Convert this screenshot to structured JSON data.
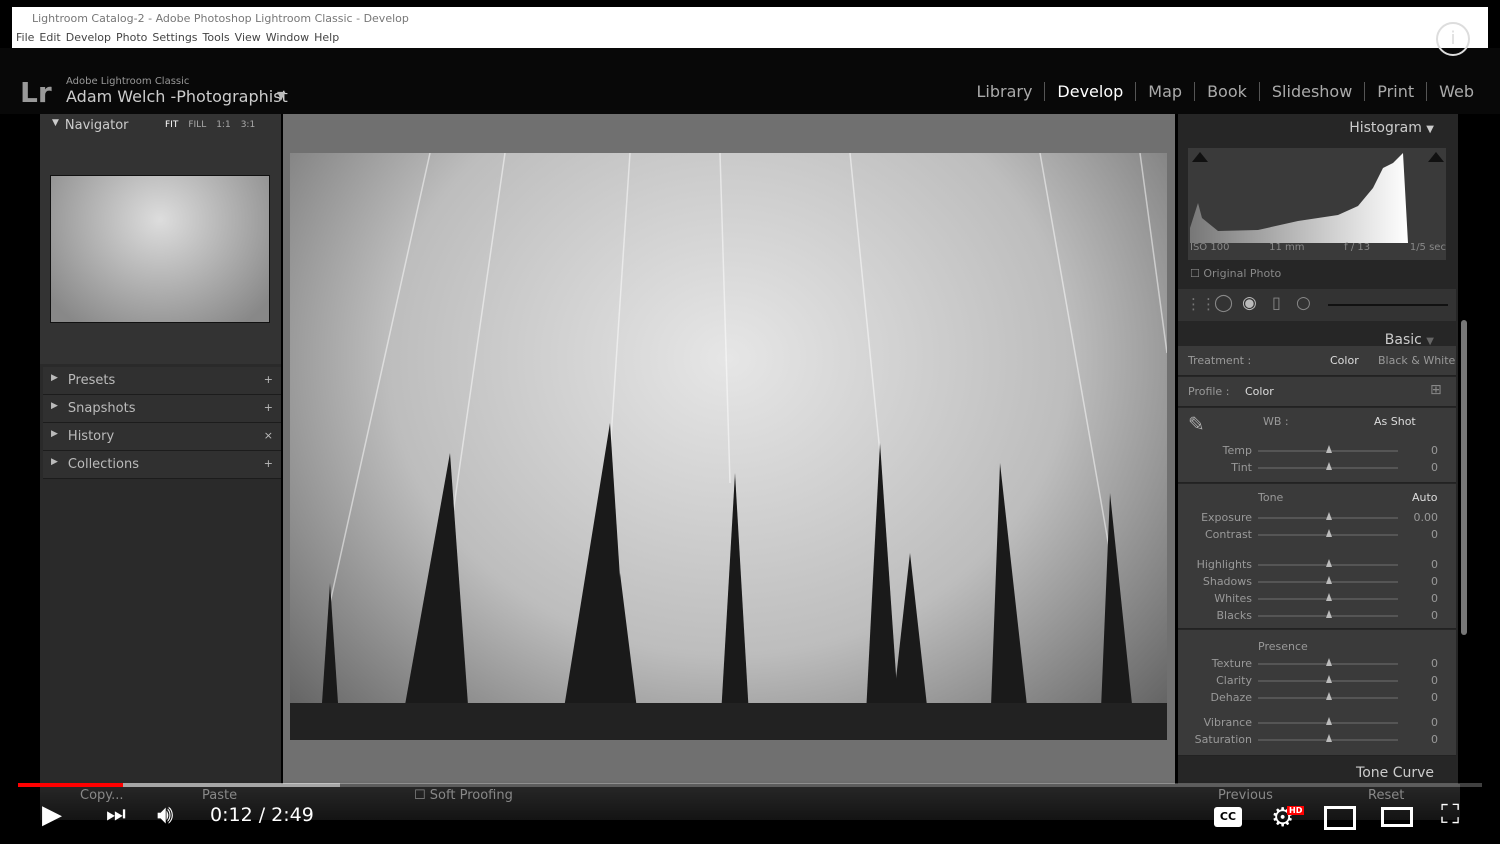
{
  "window": {
    "title": "Lightroom Catalog-2 - Adobe Photoshop Lightroom Classic - Develop",
    "menu": [
      "File",
      "Edit",
      "Develop",
      "Photo",
      "Settings",
      "Tools",
      "View",
      "Window",
      "Help"
    ]
  },
  "header": {
    "logo": "Lr",
    "app": "Adobe Lightroom Classic",
    "user": "Adam Welch -Photographist",
    "modules": [
      "Library",
      "Develop",
      "Map",
      "Book",
      "Slideshow",
      "Print",
      "Web"
    ],
    "active": "Develop"
  },
  "left": {
    "navigator": "Navigator",
    "zooms": [
      "FIT",
      "FILL",
      "1:1",
      "3:1"
    ],
    "panels": [
      {
        "label": "Presets",
        "action": "+"
      },
      {
        "label": "Snapshots",
        "action": "+"
      },
      {
        "label": "History",
        "action": "×"
      },
      {
        "label": "Collections",
        "action": "+"
      }
    ]
  },
  "right": {
    "histogram": "Histogram",
    "exif": [
      "ISO 100",
      "11 mm",
      "f / 13",
      "1/5 sec"
    ],
    "original": "Original Photo",
    "basic": "Basic",
    "treatment": {
      "label": "Treatment :",
      "color": "Color",
      "bw": "Black & White"
    },
    "profile": {
      "label": "Profile :",
      "value": "Color"
    },
    "wb": {
      "label": "WB :",
      "value": "As Shot"
    },
    "tone": {
      "label": "Tone",
      "auto": "Auto"
    },
    "presence": "Presence",
    "sliders": [
      {
        "name": "Temp",
        "value": "0"
      },
      {
        "name": "Tint",
        "value": "0"
      },
      {
        "name": "Exposure",
        "value": "0.00"
      },
      {
        "name": "Contrast",
        "value": "0"
      },
      {
        "name": "Highlights",
        "value": "0"
      },
      {
        "name": "Shadows",
        "value": "0"
      },
      {
        "name": "Whites",
        "value": "0"
      },
      {
        "name": "Blacks",
        "value": "0"
      },
      {
        "name": "Texture",
        "value": "0"
      },
      {
        "name": "Clarity",
        "value": "0"
      },
      {
        "name": "Dehaze",
        "value": "0"
      },
      {
        "name": "Vibrance",
        "value": "0"
      },
      {
        "name": "Saturation",
        "value": "0"
      }
    ],
    "tonecurve": "Tone Curve",
    "previous": "Previous",
    "reset": "Reset"
  },
  "bottom": {
    "copy": "Copy...",
    "paste": "Paste",
    "softproof": "Soft Proofing"
  },
  "player": {
    "time": "0:12 / 2:49",
    "progress": 0.072,
    "buffered": 0.22,
    "accent": "#ff0000",
    "hd": "HD"
  }
}
